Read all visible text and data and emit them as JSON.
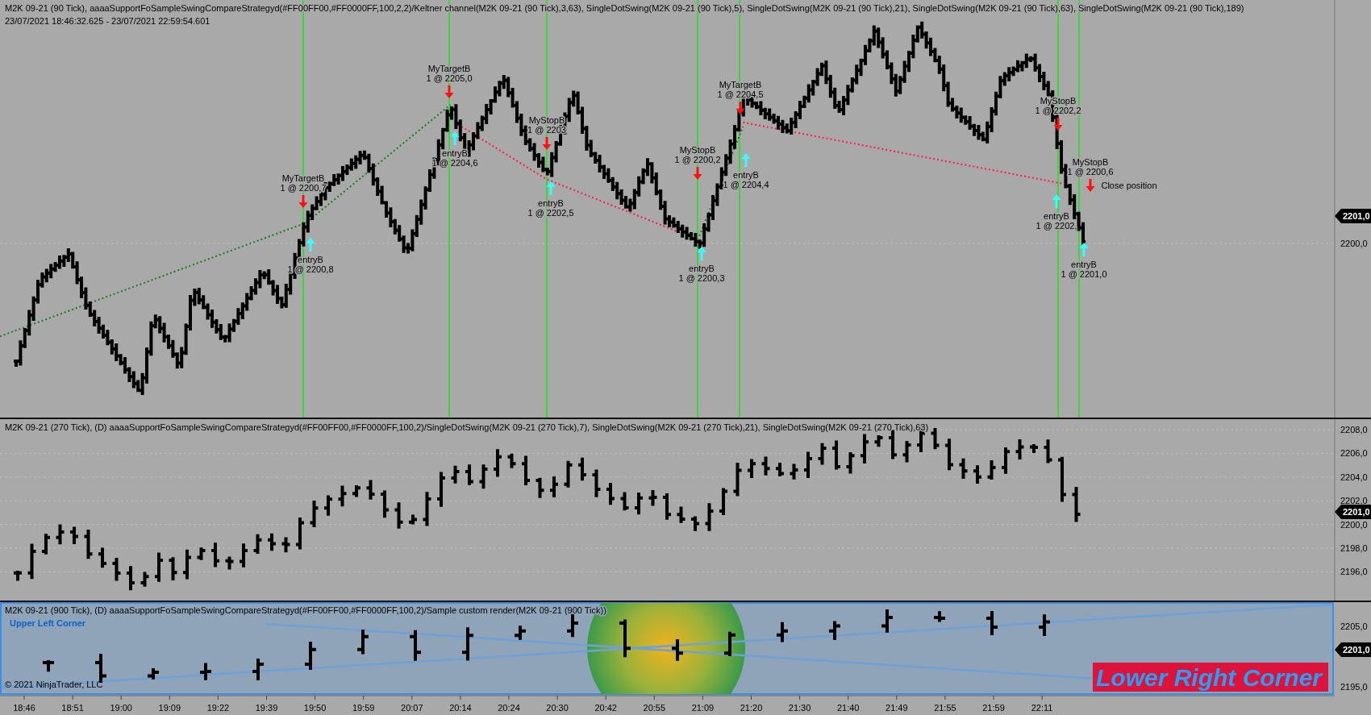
{
  "price_panel": {
    "title": "M2K 09-21 (90 Tick), aaaaSupportFoSampleSwingCompareStrategyd(#FF00FF00,#FF0000FF,100,2,2)/Keltner channel(M2K 09-21 (90 Tick),3,63), SingleDotSwing(M2K 09-21 (90 Tick),5), SingleDotSwing(M2K 09-21 (90 Tick),21), SingleDotSwing(M2K 09-21 (90 Tick),63), SingleDotSwing(M2K 09-21 (90 Tick),189)",
    "range": "23/07/2021 18:46:32.625 - 23/07/2021 22:59:54.601",
    "axis_labels": [
      "2200,0"
    ],
    "last_price": "2201,0",
    "trades": [
      {
        "kind": "target",
        "name": "MyTargetB",
        "fill": "1 @ 2200,7"
      },
      {
        "kind": "entry",
        "name": "entryB",
        "fill": "1 @ 2200,8"
      },
      {
        "kind": "target",
        "name": "MyTargetB",
        "fill": "1 @ 2205,0"
      },
      {
        "kind": "entry",
        "name": "entryB",
        "fill": "1 @ 2204,6"
      },
      {
        "kind": "stop",
        "name": "MyStopB",
        "fill": "1 @ 2203"
      },
      {
        "kind": "entry",
        "name": "entryB",
        "fill": "1 @ 2202,5"
      },
      {
        "kind": "stop",
        "name": "MyStopB",
        "fill": "1 @ 2200,2"
      },
      {
        "kind": "entry",
        "name": "entryB",
        "fill": "1 @ 2200,3"
      },
      {
        "kind": "target",
        "name": "MyTargetB",
        "fill": "1 @ 2204,5"
      },
      {
        "kind": "entry",
        "name": "entryB",
        "fill": "1 @ 2204,4"
      },
      {
        "kind": "stop",
        "name": "MyStopB",
        "fill": "1 @ 2202,2"
      },
      {
        "kind": "stop",
        "name": "MyStopB",
        "fill": "1 @ 2200,6"
      },
      {
        "kind": "exit",
        "name": "Close position"
      },
      {
        "kind": "entry",
        "name": "entryB",
        "fill": "1 @ 2202,"
      },
      {
        "kind": "entry",
        "name": "entryB",
        "fill": "1 @ 2201,0"
      }
    ]
  },
  "panel_270": {
    "title": "M2K 09-21 (270 Tick), (D) aaaaSupportFoSampleSwingCompareStrategyd(#FF00FF00,#FF0000FF,100,2)/SingleDotSwing(M2K 09-21 (270 Tick),7), SingleDotSwing(M2K 09-21 (270 Tick),21), SingleDotSwing(M2K 09-21 (270 Tick),63)",
    "axis_labels": [
      "2208,0",
      "2206,0",
      "2204,0",
      "2202,0",
      "2200,0",
      "2198,0",
      "2196,0"
    ],
    "last_price": "2201,0"
  },
  "panel_900": {
    "title": "M2K 09-21 (900 Tick), (D) aaaaSupportFoSampleSwingCompareStrategyd(#FF00FF00,#FF0000FF,100,2)/Sample custom render(M2K 09-21 (900 Tick))",
    "upper_left_text": "Upper Left Corner",
    "copyright": "© 2021 NinjaTrader, LLC",
    "lower_right_text": "Lower Right Corner",
    "axis_labels": [
      "2205,0",
      "2195,0"
    ],
    "last_price": "2201,0"
  },
  "time_axis": [
    "18:46",
    "18:51",
    "19:00",
    "19:09",
    "19:22",
    "19:39",
    "19:50",
    "19:59",
    "20:07",
    "20:14",
    "20:24",
    "20:30",
    "20:42",
    "20:55",
    "21:09",
    "21:20",
    "21:30",
    "21:40",
    "21:49",
    "21:55",
    "21:59",
    "22:11"
  ]
}
